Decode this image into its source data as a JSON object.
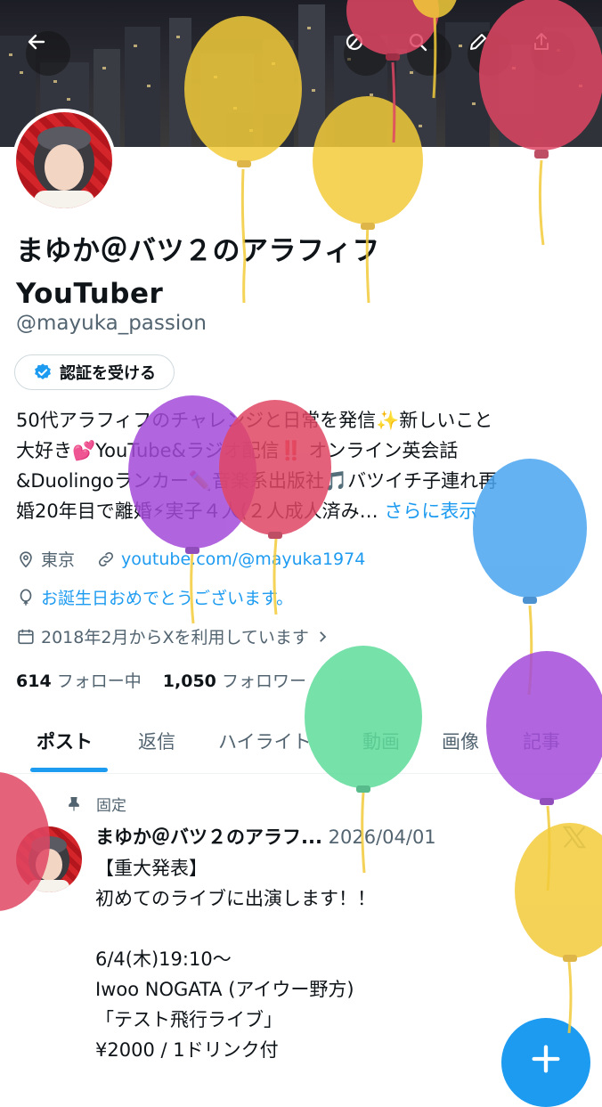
{
  "header": {
    "back_icon": "arrow-left-icon",
    "actions": [
      "circle-slash-icon",
      "search-icon",
      "edit-icon",
      "share-icon"
    ]
  },
  "profile": {
    "name_line1": "まゆか＠バツ２のアラフィフ",
    "name_line2": "YouTuber",
    "handle": "@mayuka_passion",
    "verify_label": "認証を受ける",
    "bio_1": "50代アラフィフのチャレンジと日常を発信✨新しいこと",
    "bio_2": "大好き💕YouTube&ラジオ配信‼️ オンライン英会話",
    "bio_3": "&Duolingoランカー✏️音楽系出版社🎵バツイチ子連れ再",
    "bio_4": "婚20年目で離婚⚡実子４人(２人成人済み…",
    "bio_more": "さらに表示",
    "location": "東京",
    "url": "youtube.com/@mayuka1974",
    "birthday": "お誕生日おめでとうございます。",
    "joined": "2018年2月からXを利用しています",
    "following_count": "614",
    "following_label": "フォロー中",
    "followers_count": "1,050",
    "followers_label": "フォロワー"
  },
  "tabs": [
    "ポスト",
    "返信",
    "ハイライト",
    "動画",
    "画像",
    "記事"
  ],
  "post": {
    "pinned_label": "固定",
    "author": "まゆか＠バツ２のアラフ...",
    "date": "2026/04/01",
    "body": "【重大発表】\n初めてのライブに出演します！！\n\n6/4(木)19:10〜\nIwoo NOGATA (アイウー野方)\n「テスト飛行ライブ」\n¥2000 / 1ドリンク付"
  },
  "fab_icon": "plus-icon",
  "colors": {
    "accent": "#1d9bf0",
    "balloon_yellow": "#f2cb3a",
    "balloon_red": "#e04664",
    "balloon_purple": "#a34ad8",
    "balloon_blue": "#4aa4f0",
    "balloon_green": "#5edc9a"
  }
}
